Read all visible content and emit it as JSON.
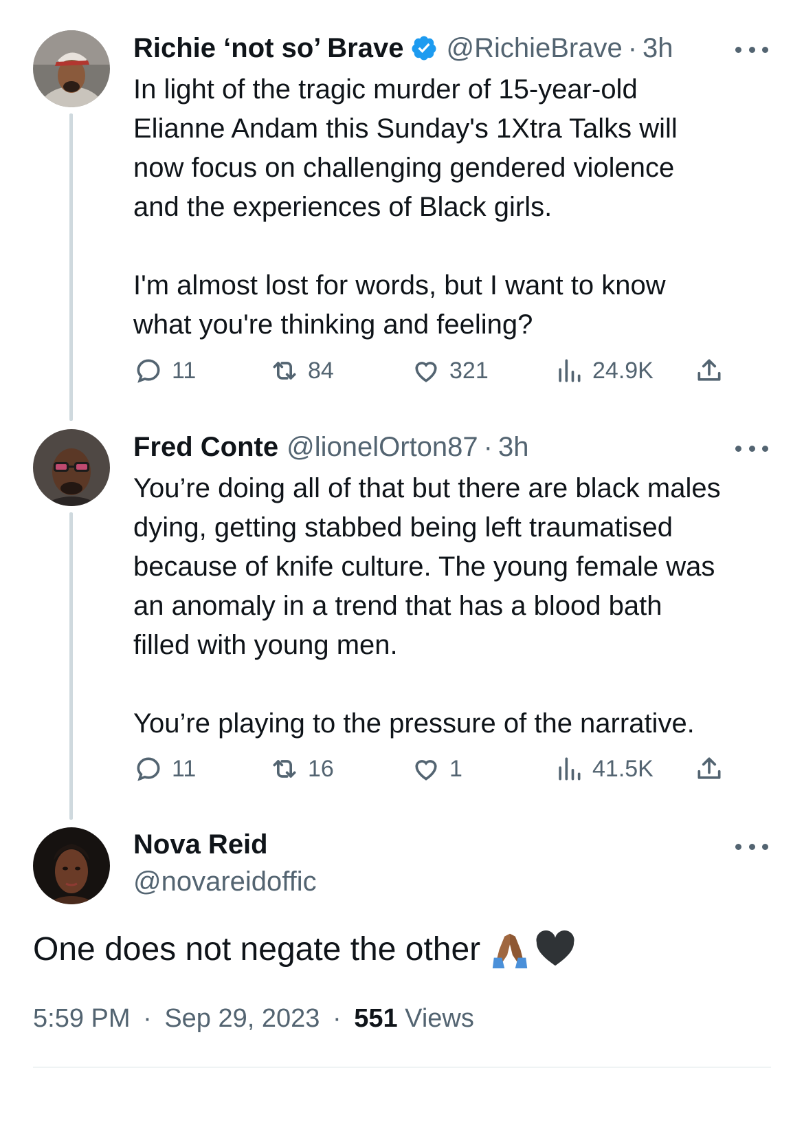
{
  "tweets": [
    {
      "name": "Richie ‘not so’ Brave",
      "handle": "@RichieBrave",
      "time": "3h",
      "verified": true,
      "text": "In light of the tragic murder of 15-year-old\nElianne Andam this Sunday's 1Xtra Talks will\nnow focus on challenging gendered violence\nand the experiences of Black girls.\n\nI'm almost lost for words, but I want to know\nwhat you're thinking and feeling?",
      "replies": "11",
      "reposts": "84",
      "likes": "321",
      "views": "24.9K"
    },
    {
      "name": "Fred Conte",
      "handle": "@lionelOrton87",
      "time": "3h",
      "verified": false,
      "text": "You’re doing all of that but there are black males\ndying, getting stabbed being left traumatised\nbecause of knife culture. The young female was\nan anomaly in a trend that has a blood bath\nfilled with young men.\n\nYou’re playing to the pressure of the narrative.",
      "replies": "11",
      "reposts": "16",
      "likes": "1",
      "views": "41.5K"
    }
  ],
  "main": {
    "name": "Nova Reid",
    "handle": "@novareidoffic",
    "text": "One does not negate the other",
    "emojis": [
      "folded-hands-icon",
      "black-heart-icon"
    ],
    "time": "5:59 PM",
    "date": "Sep 29, 2023",
    "views_count": "551",
    "views_label": "Views"
  },
  "separator": "·",
  "colors": {
    "text": "#0f1419",
    "secondary": "#536471",
    "verified": "#1d9bf0",
    "thread_line": "#cfd9de"
  }
}
